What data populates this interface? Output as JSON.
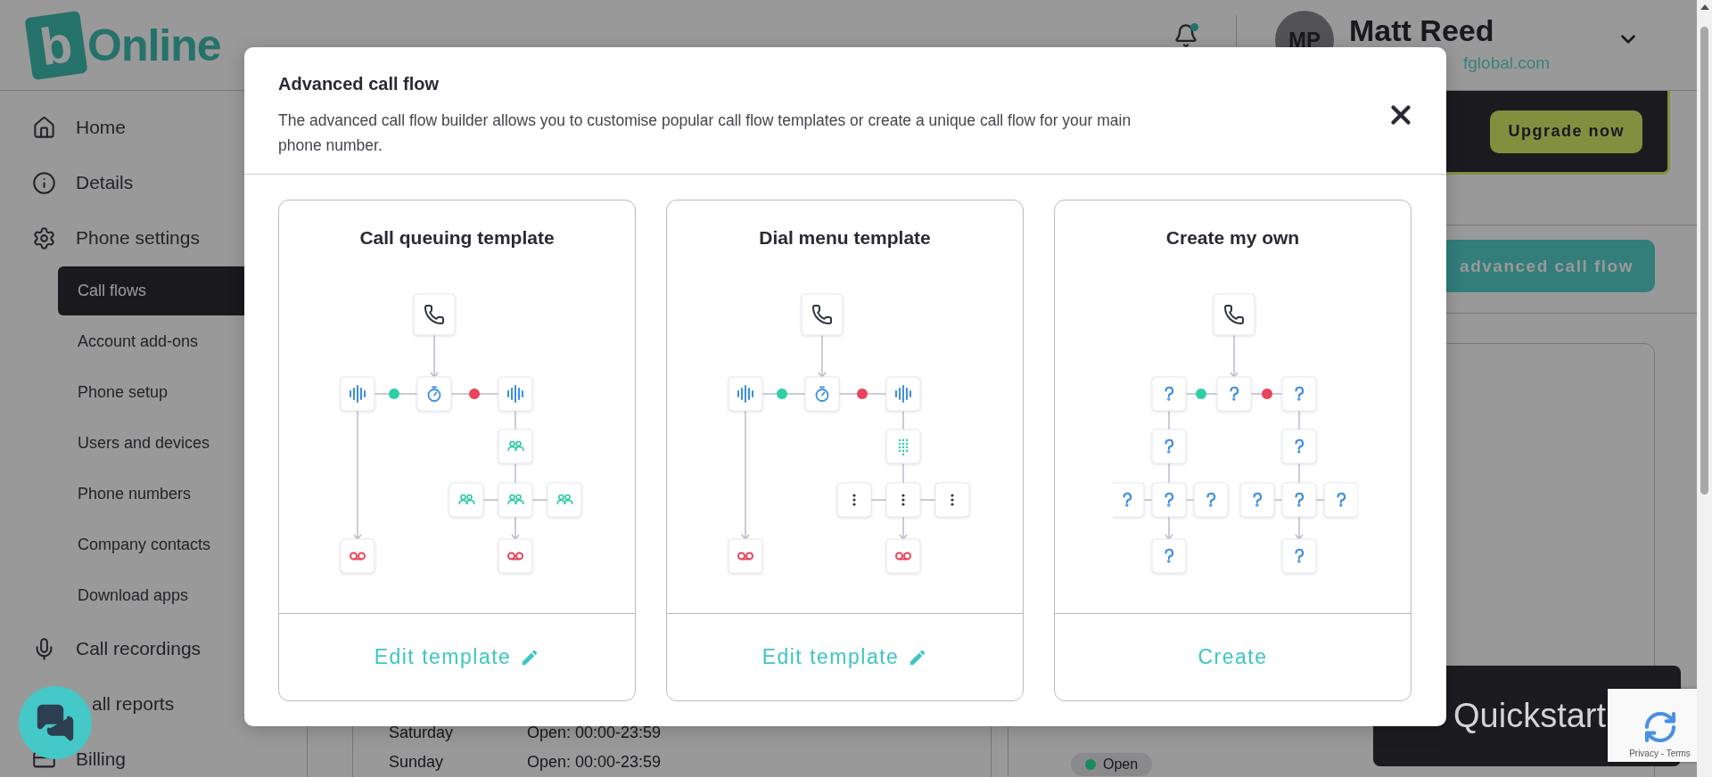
{
  "logo": {
    "mark": "b",
    "text": "Online"
  },
  "header": {
    "avatar_initials": "MP",
    "user_name": "Matt Reed",
    "user_email": "fglobal.com"
  },
  "sidebar": {
    "items": [
      {
        "label": "Home",
        "kind": "home",
        "selected": false
      },
      {
        "label": "Details",
        "kind": "info",
        "selected": false
      },
      {
        "label": "Phone settings",
        "kind": "settings",
        "selected": false,
        "children": [
          {
            "label": "Call flows",
            "selected": true
          },
          {
            "label": "Account add-ons",
            "selected": false
          },
          {
            "label": "Phone setup",
            "selected": false
          },
          {
            "label": "Users and devices",
            "selected": false
          },
          {
            "label": "Phone numbers",
            "selected": false
          },
          {
            "label": "Company contacts",
            "selected": false
          },
          {
            "label": "Download apps",
            "selected": false
          }
        ]
      },
      {
        "label": "Call recordings",
        "kind": "mic",
        "selected": false
      },
      {
        "label": "all reports",
        "kind": "reports",
        "selected": false
      },
      {
        "label": "Billing",
        "kind": "billing",
        "selected": false
      }
    ]
  },
  "banner": {
    "button": "Upgrade now"
  },
  "advanced_button": "advanced call flow",
  "schedule": [
    {
      "day": "Saturday",
      "hours": "Open: 00:00-23:59"
    },
    {
      "day": "Sunday",
      "hours": "Open: 00:00-23:59"
    }
  ],
  "flow_preview": {
    "outcomes": [
      {
        "label": "Open",
        "color": "#1a8a5f"
      }
    ]
  },
  "quickstart": "Quickstart",
  "recaptcha": "Privacy - Terms",
  "modal": {
    "title": "Advanced call flow",
    "description": "The advanced call flow builder allows you to customise popular call flow templates or create a unique call flow for your main phone number.",
    "cards": [
      {
        "title": "Call queuing template",
        "kind": "queue",
        "action": "Edit template",
        "pencil": true
      },
      {
        "title": "Dial menu template",
        "kind": "menu",
        "action": "Edit template",
        "pencil": true
      },
      {
        "title": "Create my own",
        "kind": "custom",
        "action": "Create",
        "pencil": false
      }
    ]
  }
}
